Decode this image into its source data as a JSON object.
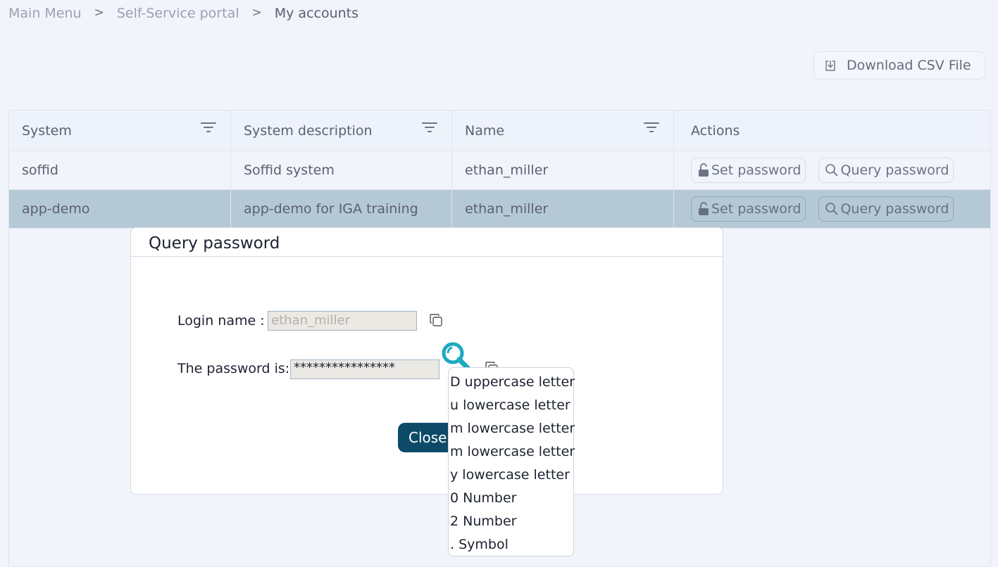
{
  "breadcrumb": {
    "items": [
      "Main Menu",
      "Self-Service portal",
      "My accounts"
    ],
    "separator": ">"
  },
  "toolbar": {
    "download_label": "Download CSV File",
    "download_icon": "download-icon"
  },
  "table": {
    "columns": [
      "System",
      "System description",
      "Name",
      "Actions"
    ],
    "rows": [
      {
        "system": "soffid",
        "description": "Soffid system",
        "name": "ethan_miller",
        "selected": false
      },
      {
        "system": "app-demo",
        "description": "app-demo for IGA training",
        "name": "ethan_miller",
        "selected": true
      }
    ],
    "actions": {
      "set_password": "Set password",
      "query_password": "Query password"
    }
  },
  "dialog": {
    "title": "Query password",
    "login_label": "Login name :",
    "login_value": "ethan_miller",
    "password_label": "The password is:",
    "password_value": "****************",
    "close_label": "Close"
  },
  "popup": {
    "items": [
      "D uppercase letter",
      "u lowercase letter",
      "m lowercase letter",
      "m lowercase letter",
      "y lowercase letter",
      "0 Number",
      "2 Number",
      ". Symbol"
    ]
  },
  "colors": {
    "accent": "#0d4a68",
    "selected_row": "#b5c8d6",
    "magnifier": "#1fa9c2",
    "background": "#f1f4fb"
  }
}
